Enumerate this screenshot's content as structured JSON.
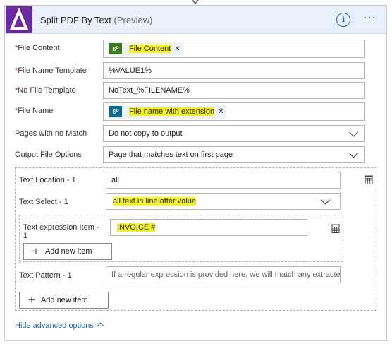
{
  "header": {
    "title": "Split PDF By Text",
    "subtitle": "(Preview)",
    "info_icon": "i",
    "more_icon": "···"
  },
  "fields": {
    "file_content": {
      "required": "*",
      "label": "File Content",
      "token": "File Content",
      "token_icon": "sharepoint-icon",
      "token_icon_color": "#3a7a1f"
    },
    "file_name_template": {
      "required": "*",
      "label": "File Name Template",
      "value": "%VALUE1%"
    },
    "no_file_template": {
      "required": "*",
      "label": "No File Template",
      "value": "NoText_%FILENAME%"
    },
    "file_name": {
      "required": "*",
      "label": "File Name",
      "token": "File name with extension",
      "token_icon": "sharepoint-icon",
      "token_icon_color": "#0b6a8f"
    },
    "pages_no_match": {
      "label": "Pages with no Match",
      "value": "Do not copy to output"
    },
    "output_file_options": {
      "label": "Output File Options",
      "value": "Page that matches text on first page"
    }
  },
  "array_item": {
    "text_location": {
      "label": "Text Location - 1",
      "value": "all"
    },
    "text_select": {
      "label": "Text Select - 1",
      "value": "all text in line after value"
    },
    "text_expression": {
      "label": "Text expression Item -",
      "label2": "1",
      "value": "INVOICE #"
    },
    "inner_add_label": "Add new item",
    "text_pattern": {
      "label": "Text Pattern - 1",
      "placeholder": "If a regular expression is provided here, we will match any extracte"
    },
    "outer_add_label": "Add new item"
  },
  "footer": {
    "advanced_link": "Hide advanced options"
  },
  "colors": {
    "header_bg": "#e8f1fb",
    "logo_bg": "#6a2aa0",
    "accent": "#2266b8",
    "highlight": "#f5f31a"
  }
}
